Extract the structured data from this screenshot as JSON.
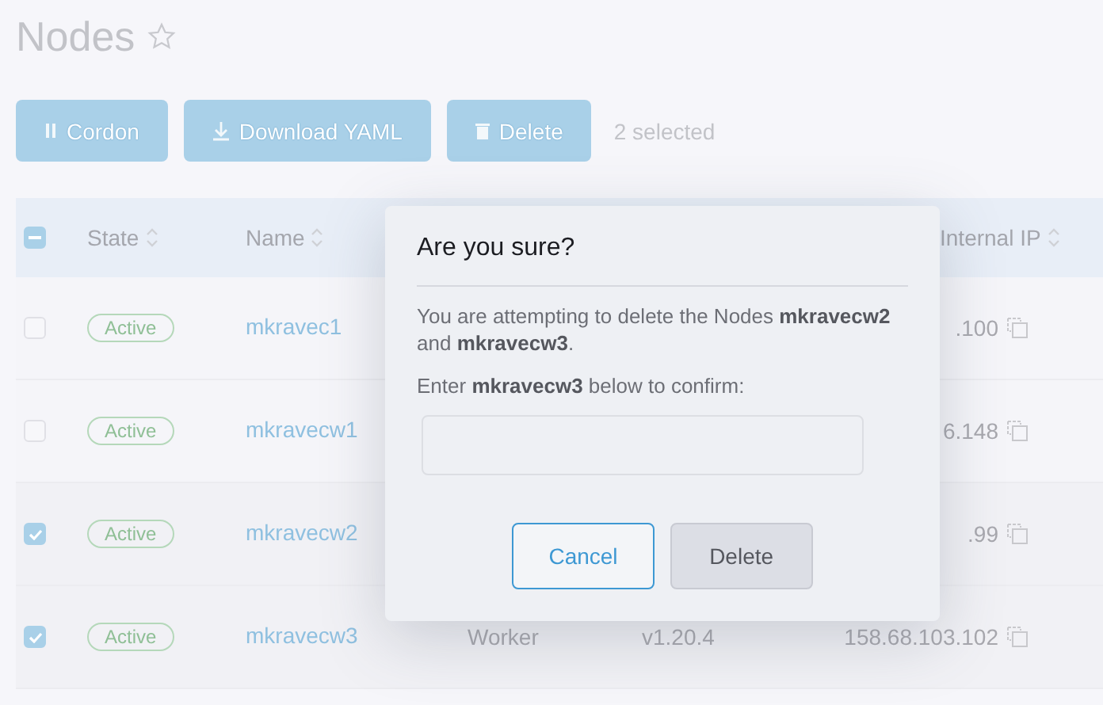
{
  "page": {
    "title": "Nodes",
    "favorite": false
  },
  "toolbar": {
    "buttons": [
      {
        "label": "Cordon",
        "kind": "pause"
      },
      {
        "label": "Download YAML",
        "kind": "download"
      },
      {
        "label": "Delete",
        "kind": "trash"
      }
    ],
    "selection_count": "2 selected"
  },
  "table": {
    "header_checkbox": {
      "indeterminate": true
    },
    "columns": [
      {
        "label": "State",
        "kind": "state"
      },
      {
        "label": "Name",
        "kind": "name"
      },
      {
        "label": "Internal IP",
        "kind": "ip"
      }
    ],
    "rows": [
      {
        "checked": false,
        "state": "Active",
        "name": "mkravec1",
        "ip": ".100"
      },
      {
        "checked": false,
        "state": "Active",
        "name": "mkravecw1",
        "ip": "6.148"
      },
      {
        "checked": true,
        "state": "Active",
        "name": "mkravecw2",
        "ip": ".99"
      },
      {
        "checked": true,
        "state": "Active",
        "name": "mkravecw3",
        "role": "Worker",
        "version": "v1.20.4",
        "ip": "158.68.103.102"
      }
    ]
  },
  "dialog": {
    "title": "Are you sure?",
    "message": "You are attempting to delete the Nodes **mkravecw2** and **mkravecw3**.",
    "prompt": "Enter **mkravecw3** below to confirm:",
    "buttons": [
      {
        "label": "Cancel",
        "kind": "secondary"
      },
      {
        "label": "Delete",
        "kind": "danger"
      }
    ]
  }
}
